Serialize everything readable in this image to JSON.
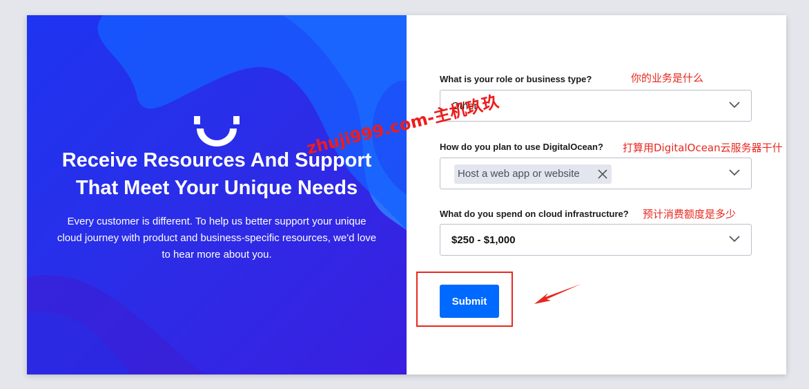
{
  "hero": {
    "title_line1": "Receive Resources And Support",
    "title_line2": "That Meet Your Unique Needs",
    "description": "Every customer is different. To help us better support your unique cloud journey with product and business-specific resources, we'd love to hear more about you.",
    "logo_icon": "smile-icon"
  },
  "form": {
    "role": {
      "label": "What is your role or business type?",
      "value": "Other",
      "annotation": "你的业务是什么"
    },
    "plan": {
      "label": "How do you plan to use DigitalOcean?",
      "chip": "Host a web app or website",
      "annotation": "打算用DigitalOcean云服务器干什"
    },
    "spend": {
      "label": "What do you spend on cloud infrastructure?",
      "value": "$250 - $1,000",
      "annotation": "预计消费额度是多少"
    },
    "submit_label": "Submit"
  },
  "watermark": "zhuji999.com-主机玖玖",
  "colors": {
    "accent": "#0069ff",
    "annotation": "#e8271e",
    "hero_blue": "#1e34f0"
  }
}
